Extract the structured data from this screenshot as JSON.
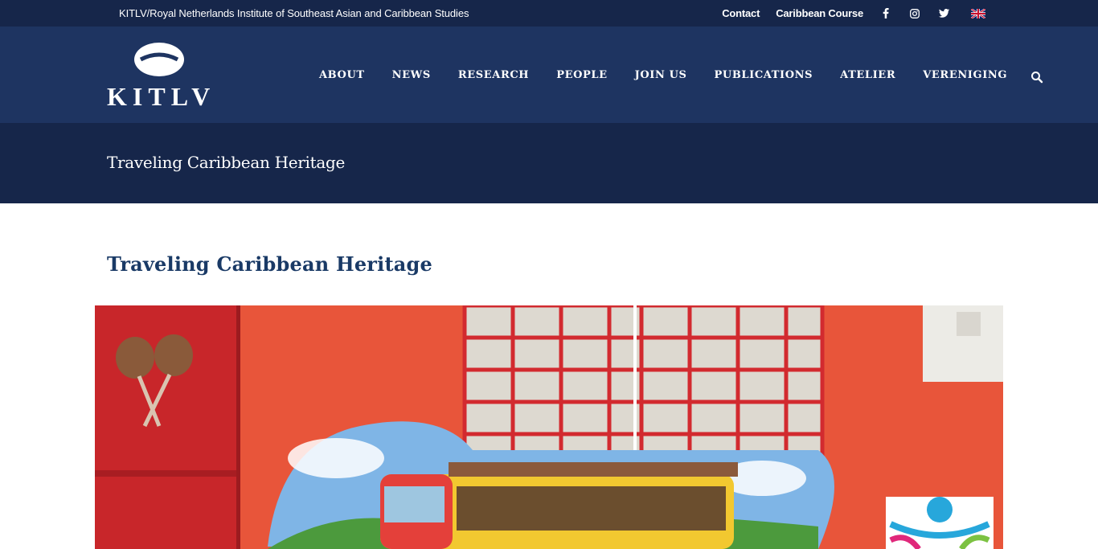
{
  "topbar": {
    "institute": "KITLV/Royal Netherlands Institute of Southeast Asian and Caribbean Studies",
    "links": [
      "Contact",
      "Caribbean Course"
    ],
    "social_icons": [
      "facebook-icon",
      "instagram-icon",
      "twitter-icon"
    ],
    "language_icon": "uk-flag-icon"
  },
  "header": {
    "logo_text": "KITLV",
    "nav": [
      "ABOUT",
      "NEWS",
      "RESEARCH",
      "PEOPLE",
      "JOIN US",
      "PUBLICATIONS",
      "ATELIER",
      "VERENIGING"
    ],
    "search_icon": "search-icon"
  },
  "page": {
    "banner_title": "Traveling Caribbean Heritage",
    "content_title": "Traveling Caribbean Heritage"
  },
  "colors": {
    "topbar_bg": "#16264a",
    "header_bg": "#1e3461",
    "title_band_bg": "#16264a",
    "heading_color": "#1a3a66"
  }
}
